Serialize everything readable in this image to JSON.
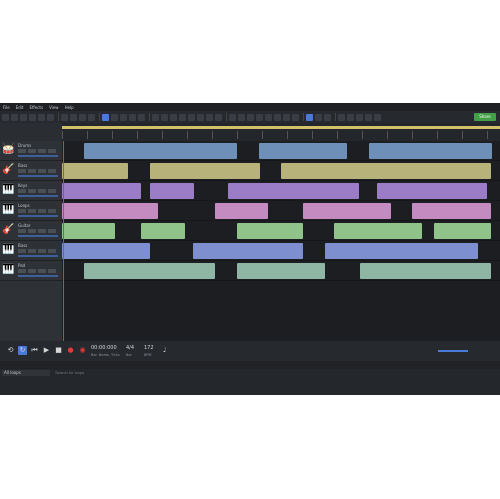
{
  "menu": [
    "File",
    "Edit",
    "Effects",
    "View",
    "Help"
  ],
  "share_label": "Share",
  "tracks": [
    {
      "name": "Drums",
      "icon": "drums-icon",
      "glyph": "🥁"
    },
    {
      "name": "Bass",
      "icon": "guitar-icon",
      "glyph": "🎸"
    },
    {
      "name": "Keys",
      "icon": "keyboard-icon",
      "glyph": "🎹"
    },
    {
      "name": "Loops",
      "icon": "keyboard-icon",
      "glyph": "🎹"
    },
    {
      "name": "Guitar",
      "icon": "guitar-icon",
      "glyph": "🎸"
    },
    {
      "name": "Bass",
      "icon": "keyboard-icon",
      "glyph": "🎹"
    },
    {
      "name": "Pad",
      "icon": "keyboard-icon",
      "glyph": "🎹"
    }
  ],
  "clip_colors": {
    "drums": "#6d8fb8",
    "bass": "#b7b27a",
    "keys": "#9a7dc6",
    "loops": "#c48bc0",
    "guitar": "#8fc38a",
    "synth": "#7e8fd0",
    "pad": "#8fb6a4"
  },
  "transport": {
    "time": "00:00:000",
    "time_sub": "Bar. Beats. Ticks",
    "signature": "4/4",
    "signature_sub": "Bar",
    "tempo": "172",
    "tempo_sub": "BPM"
  },
  "browser": {
    "select": "All loops",
    "search_placeholder": "Search for loops"
  }
}
